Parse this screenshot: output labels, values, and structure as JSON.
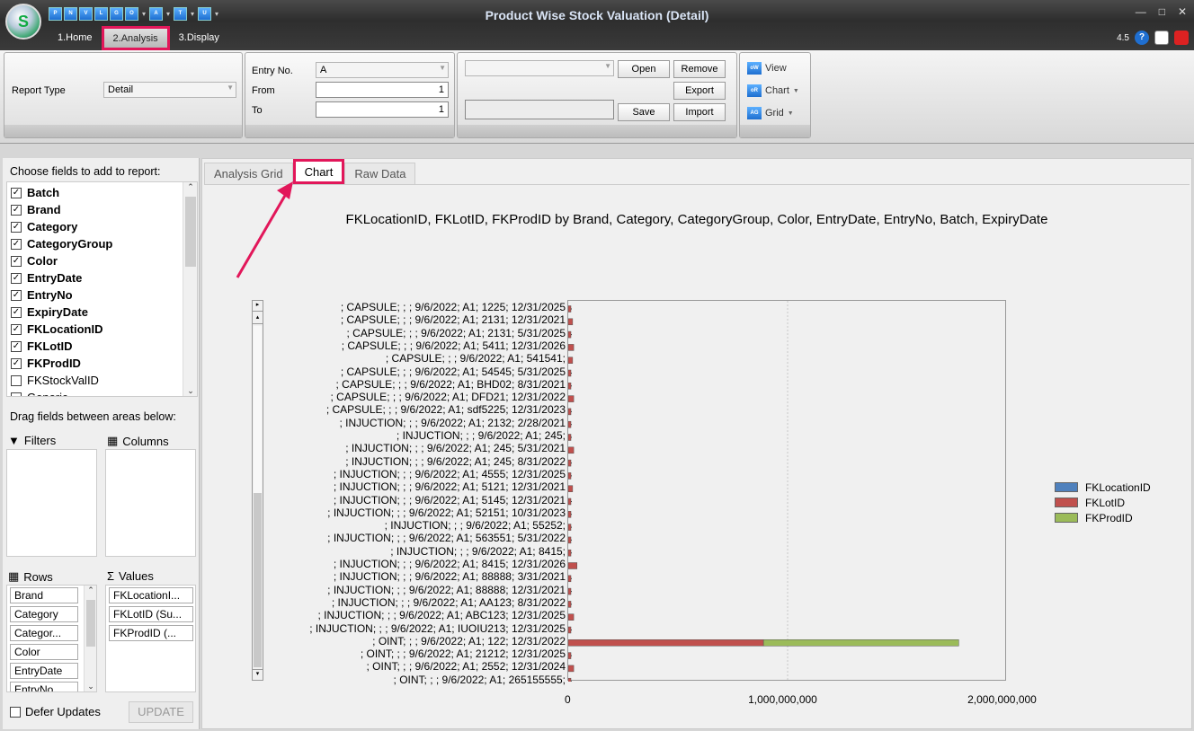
{
  "window": {
    "title": "Product Wise Stock Valuation (Detail)",
    "version": "4.5",
    "quick_access": [
      "P",
      "N",
      "V",
      "L",
      "G",
      "O",
      "A",
      "T",
      "U"
    ]
  },
  "menu": [
    {
      "label": "1.Home"
    },
    {
      "label": "2.Analysis"
    },
    {
      "label": "3.Display"
    }
  ],
  "ribbon": {
    "report_type_label": "Report Type",
    "report_type_value": "Detail",
    "entry_no_label": "Entry No.",
    "entry_no_value": "A",
    "from_label": "From",
    "from_value": "1",
    "to_label": "To",
    "to_value": "1",
    "open": "Open",
    "remove": "Remove",
    "export": "Export",
    "save": "Save",
    "import": "Import",
    "view": "View",
    "chart": "Chart",
    "grid": "Grid"
  },
  "field_panel": {
    "choose_label": "Choose fields to add to report:",
    "fields": [
      {
        "label": "Batch",
        "checked": true
      },
      {
        "label": "Brand",
        "checked": true
      },
      {
        "label": "Category",
        "checked": true
      },
      {
        "label": "CategoryGroup",
        "checked": true
      },
      {
        "label": "Color",
        "checked": true
      },
      {
        "label": "EntryDate",
        "checked": true
      },
      {
        "label": "EntryNo",
        "checked": true
      },
      {
        "label": "ExpiryDate",
        "checked": true
      },
      {
        "label": "FKLocationID",
        "checked": true
      },
      {
        "label": "FKLotID",
        "checked": true
      },
      {
        "label": "FKProdID",
        "checked": true
      },
      {
        "label": "FKStockValID",
        "checked": false
      },
      {
        "label": "Generic",
        "checked": false
      }
    ],
    "drag_label": "Drag fields between areas below:",
    "filters": "Filters",
    "columns": "Columns",
    "rows": "Rows",
    "values": "Values",
    "row_fields": [
      "Brand",
      "Category",
      "Categor...",
      "Color",
      "EntryDate",
      "EntryNo"
    ],
    "value_fields": [
      "FKLocationI...",
      "FKLotID (Su...",
      "FKProdID (..."
    ],
    "defer_updates": "Defer Updates",
    "update": "UPDATE"
  },
  "tabs": [
    {
      "label": "Analysis Grid"
    },
    {
      "label": "Chart"
    },
    {
      "label": "Raw Data"
    }
  ],
  "colors": {
    "FKLocationID": "#4f81bd",
    "FKLotID": "#c0504d",
    "FKProdID": "#9bbb59",
    "highlight": "#e2175a"
  },
  "chart_data": {
    "type": "bar",
    "orientation": "horizontal",
    "stacked": true,
    "title": "FKLocationID, FKLotID, FKProdID by Brand, Category, CategoryGroup, Color, EntryDate, EntryNo, Batch, ExpiryDate",
    "xlim": [
      0,
      2000000000
    ],
    "xticks": [
      "0",
      "1,000,000,000",
      "2,000,000,000"
    ],
    "grid": true,
    "legend_position": "right",
    "categories": [
      "; CAPSULE; ; ; 9/6/2022; A1; 1225; 12/31/2025",
      "; CAPSULE; ; ; 9/6/2022; A1; 2131; 12/31/2021",
      "; CAPSULE; ; ; 9/6/2022; A1; 2131; 5/31/2025",
      "; CAPSULE; ; ; 9/6/2022; A1; 5411; 12/31/2026",
      "; CAPSULE; ; ; 9/6/2022; A1; 541541;",
      "; CAPSULE; ; ; 9/6/2022; A1; 54545; 5/31/2025",
      "; CAPSULE; ; ; 9/6/2022; A1; BHD02; 8/31/2021",
      "; CAPSULE; ; ; 9/6/2022; A1; DFD21; 12/31/2022",
      "; CAPSULE; ; ; 9/6/2022; A1; sdf5225; 12/31/2023",
      "; INJUCTION; ; ; 9/6/2022; A1; 2132; 2/28/2021",
      "; INJUCTION; ; ; 9/6/2022; A1; 245;",
      "; INJUCTION; ; ; 9/6/2022; A1; 245; 5/31/2021",
      "; INJUCTION; ; ; 9/6/2022; A1; 245; 8/31/2022",
      "; INJUCTION; ; ; 9/6/2022; A1; 4555; 12/31/2025",
      "; INJUCTION; ; ; 9/6/2022; A1; 5121; 12/31/2021",
      "; INJUCTION; ; ; 9/6/2022; A1; 5145; 12/31/2021",
      "; INJUCTION; ; ; 9/6/2022; A1; 52151; 10/31/2023",
      "; INJUCTION; ; ; 9/6/2022; A1; 55252;",
      "; INJUCTION; ; ; 9/6/2022; A1; 563551; 5/31/2022",
      "; INJUCTION; ; ; 9/6/2022; A1; 8415;",
      "; INJUCTION; ; ; 9/6/2022; A1; 8415; 12/31/2026",
      "; INJUCTION; ; ; 9/6/2022; A1; 88888; 3/31/2021",
      "; INJUCTION; ; ; 9/6/2022; A1; 88888; 12/31/2021",
      "; INJUCTION; ; ; 9/6/2022; A1; AA123; 8/31/2022",
      "; INJUCTION; ; ; 9/6/2022; A1; ABC123; 12/31/2025",
      "; INJUCTION; ; ; 9/6/2022; A1; IUOIU213; 12/31/2025",
      "; OINT; ; ; 9/6/2022; A1; 122; 12/31/2022",
      "; OINT; ; ; 9/6/2022; A1; 21212; 12/31/2025",
      "; OINT; ; ; 9/6/2022; A1; 2552; 12/31/2024",
      "; OINT; ; ; 9/6/2022; A1; 265155555;"
    ],
    "series": [
      {
        "name": "FKLocationID",
        "values": [
          0,
          0,
          0,
          0,
          0,
          0,
          0,
          0,
          0,
          0,
          0,
          0,
          0,
          0,
          0,
          0,
          0,
          0,
          0,
          0,
          0,
          0,
          0,
          0,
          0,
          0,
          0,
          0,
          0,
          0
        ]
      },
      {
        "name": "FKLotID",
        "values": [
          5000000,
          20000000,
          4000000,
          25000000,
          20000000,
          4000000,
          4000000,
          25000000,
          3000000,
          3000000,
          2000000,
          25000000,
          4000000,
          4000000,
          20000000,
          4000000,
          3000000,
          2000000,
          3000000,
          2000000,
          40000000,
          4000000,
          3000000,
          3000000,
          25000000,
          2000000,
          890000000,
          3000000,
          25000000,
          3000000
        ]
      },
      {
        "name": "FKProdID",
        "values": [
          0,
          0,
          0,
          0,
          0,
          0,
          0,
          0,
          0,
          0,
          0,
          0,
          0,
          0,
          0,
          0,
          0,
          0,
          0,
          0,
          0,
          0,
          0,
          0,
          0,
          0,
          890000000,
          0,
          0,
          0
        ]
      }
    ]
  }
}
